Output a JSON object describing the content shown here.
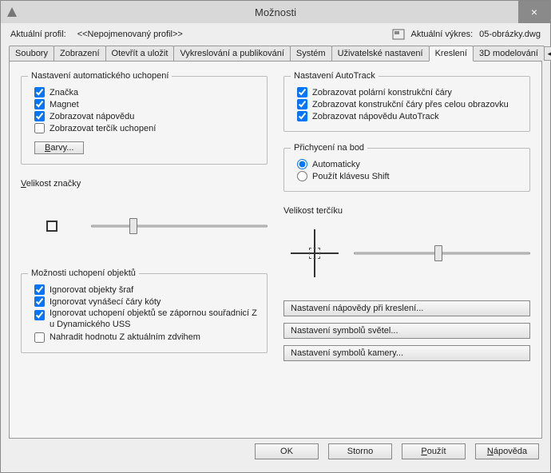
{
  "window": {
    "title": "Možnosti"
  },
  "profile": {
    "label": "Aktuální profil:",
    "name": "<<Nepojmenovaný profil>>",
    "drawing_label": "Aktuální výkres:",
    "drawing_name": "05-obrázky.dwg"
  },
  "tabs": {
    "items": [
      "Soubory",
      "Zobrazení",
      "Otevřít a uložit",
      "Vykreslování a publikování",
      "Systém",
      "Uživatelské nastavení",
      "Kreslení",
      "3D modelování"
    ],
    "active_index": 6
  },
  "left": {
    "autosnap": {
      "title": "Nastavení automatického uchopení",
      "marker": "Značka",
      "magnet": "Magnet",
      "tooltip": "Zobrazovat nápovědu",
      "aperture": "Zobrazovat terčík uchopení",
      "colors_btn": "Barvy..."
    },
    "marker_size": {
      "title": "Velikost značky"
    },
    "osnap_opts": {
      "title": "Možnosti uchopení objektů",
      "hatch": "Ignorovat objekty šraf",
      "dimext": "Ignorovat vynášecí čáry kóty",
      "negz": "Ignorovat uchopení objektů se zápornou souřadnicí Z u Dynamického USS",
      "replacez": "Nahradit hodnotu Z aktuálním zdvihem"
    }
  },
  "right": {
    "autotrack": {
      "title": "Nastavení AutoTrack",
      "polar": "Zobrazovat polární konstrukční čáry",
      "fullscreen": "Zobrazovat konstrukční čáry přes celou obrazovku",
      "tooltip": "Zobrazovat nápovědu AutoTrack"
    },
    "acquire": {
      "title": "Přichycení na bod",
      "auto": "Automaticky",
      "shift": "Použít klávesu Shift"
    },
    "target_size": {
      "title": "Velikost terčíku"
    },
    "buttons": {
      "draft_tooltip": "Nastavení nápovědy při kreslení...",
      "light_glyph": "Nastavení symbolů světel...",
      "camera_glyph": "Nastavení symbolů kamery..."
    }
  },
  "footer": {
    "ok": "OK",
    "cancel": "Storno",
    "apply": "Použít",
    "help": "Nápověda"
  }
}
